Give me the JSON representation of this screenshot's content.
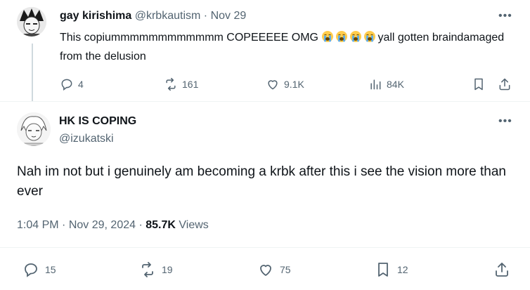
{
  "parent_tweet": {
    "display_name": "gay kirishima",
    "handle": "@krbkautism",
    "separator": "·",
    "date": "Nov 29",
    "text_before_emoji": "This copiummmmmmmmmmmm  COPEEEEE OMG ",
    "emoji_name": "loudly-crying-face",
    "emoji_count": 4,
    "text_after_emoji": "yall gotten braindamaged from the delusion",
    "more_label": "•••",
    "stats": {
      "replies": "4",
      "reposts": "161",
      "likes": "9.1K",
      "views": "84K"
    }
  },
  "main_tweet": {
    "display_name": "HK IS COPING",
    "handle": "@izukatski",
    "text": "Nah im not but i genuinely am becoming a krbk after this i see the vision more than ever",
    "more_label": "•••",
    "time": "1:04 PM",
    "dot1": "·",
    "date": "Nov 29, 2024",
    "dot2": "·",
    "views_count": "85.7K",
    "views_label": "Views",
    "stats": {
      "replies": "15",
      "reposts": "19",
      "likes": "75",
      "bookmarks": "12"
    }
  },
  "colors": {
    "text": "#0f1419",
    "muted": "#536471",
    "divider": "#eff3f4",
    "thread_line": "#cfd9de"
  }
}
